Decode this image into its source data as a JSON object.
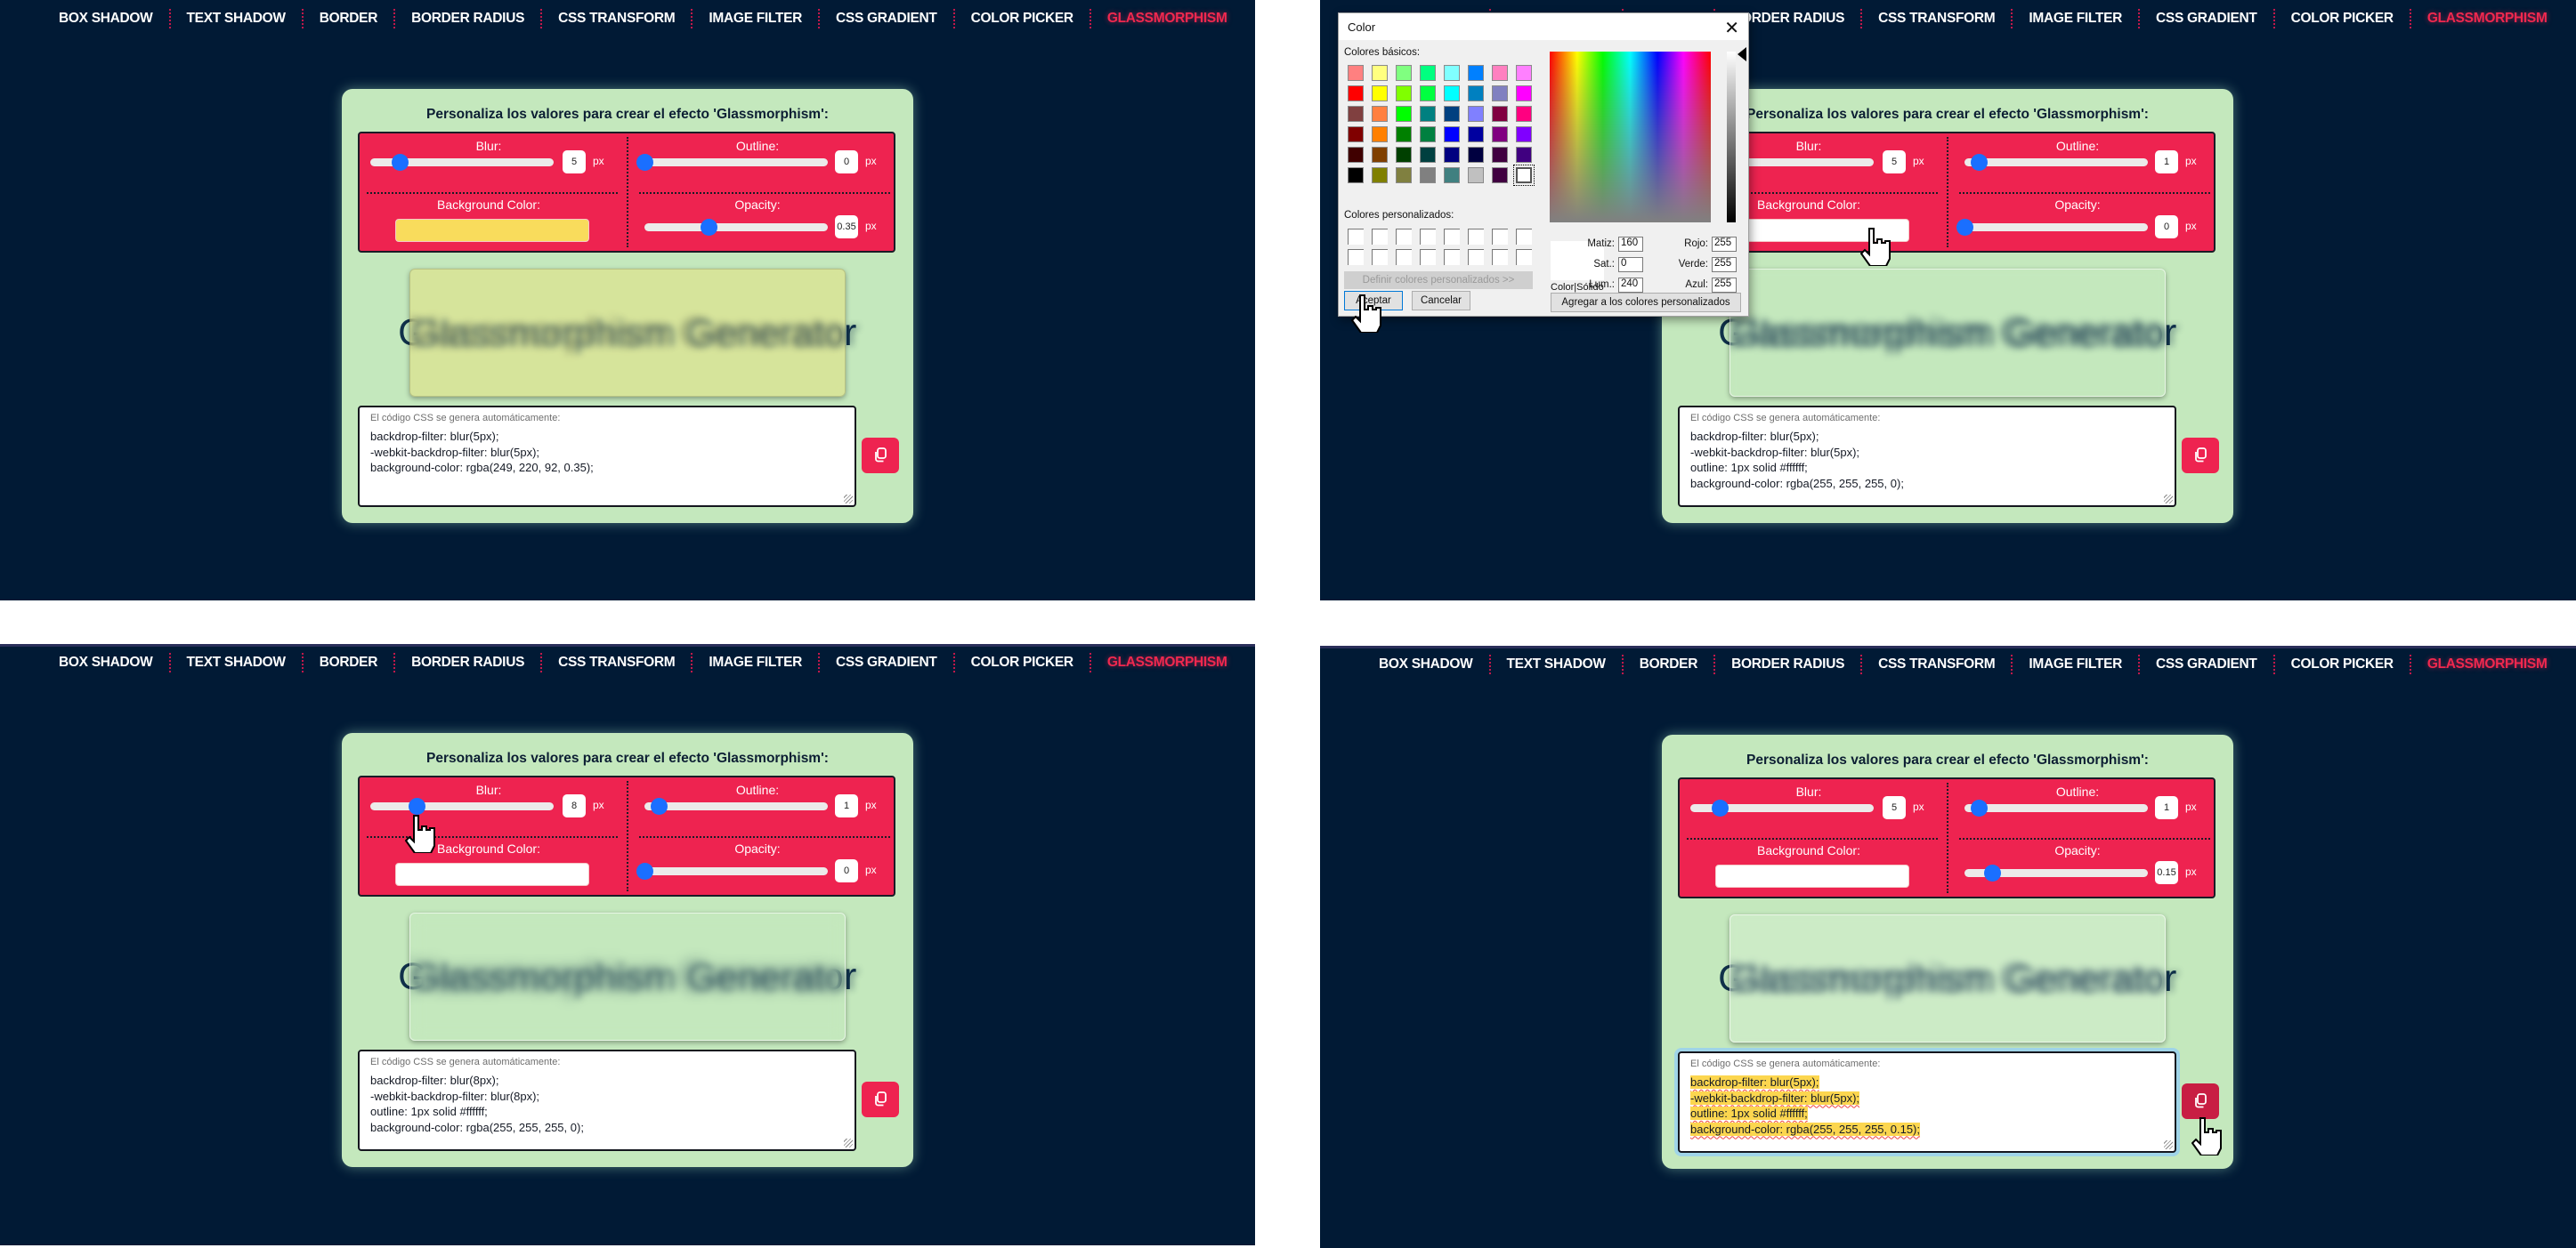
{
  "nav": {
    "items": [
      "BOX SHADOW",
      "TEXT SHADOW",
      "BORDER",
      "BORDER RADIUS",
      "CSS TRANSFORM",
      "IMAGE FILTER",
      "CSS GRADIENT",
      "COLOR PICKER",
      "GLASSMORPHISM"
    ],
    "active": "GLASSMORPHISM"
  },
  "panel": {
    "title": "Personaliza los valores para crear el efecto 'Glassmorphism':",
    "labels": {
      "blur": "Blur:",
      "outline": "Outline:",
      "bgcolor": "Background Color:",
      "opacity": "Opacity:",
      "unit": "px"
    },
    "preview_text": "Glassmorphism Generator",
    "code_placeholder": "El código CSS se genera automáticamente:"
  },
  "frames": [
    {
      "blur": 5,
      "blur_fraction": 0.16,
      "outline": 0,
      "outline_fraction": 0.0,
      "opacity": "0.35",
      "opacity_fraction": 0.35,
      "bg_color": "#f9dc5c",
      "code": [
        "backdrop-filter:  blur(5px);",
        "-webkit-backdrop-filter:  blur(5px);",
        "background-color: rgba(249, 220, 92, 0.35);"
      ]
    },
    {
      "blur": 5,
      "blur_fraction": 0.16,
      "outline": 1,
      "outline_fraction": 0.08,
      "opacity": "0",
      "opacity_fraction": 0.0,
      "bg_color": "#ffffff",
      "code": [
        "backdrop-filter:  blur(5px);",
        "-webkit-backdrop-filter:  blur(5px);",
        "outline: 1px solid #ffffff;",
        "background-color: rgba(255, 255, 255, 0);"
      ]
    },
    {
      "blur": 8,
      "blur_fraction": 0.25,
      "outline": 1,
      "outline_fraction": 0.08,
      "opacity": "0",
      "opacity_fraction": 0.0,
      "bg_color": "#ffffff",
      "code": [
        "backdrop-filter:  blur(8px);",
        "-webkit-backdrop-filter:  blur(8px);",
        "outline: 1px solid #ffffff;",
        "background-color: rgba(255, 255, 255, 0);"
      ]
    },
    {
      "blur": 5,
      "blur_fraction": 0.16,
      "outline": 1,
      "outline_fraction": 0.08,
      "opacity": "0.15",
      "opacity_fraction": 0.15,
      "bg_color": "#ffffff",
      "code": [
        "backdrop-filter:  blur(5px);",
        "-webkit-backdrop-filter:  blur(5px);",
        "outline: 1px solid #ffffff;",
        "background-color: rgba(255, 255, 255, 0.15);"
      ],
      "code_selected": true
    }
  ],
  "color_dialog": {
    "title": "Color",
    "basic_colors_label": "Colores básicos:",
    "basic_colors": [
      "#ff8080",
      "#ffff80",
      "#80ff80",
      "#00ff80",
      "#80ffff",
      "#0080ff",
      "#ff80c0",
      "#ff80ff",
      "#ff0000",
      "#ffff00",
      "#80ff00",
      "#00ff40",
      "#00ffff",
      "#0080c0",
      "#8080c0",
      "#ff00ff",
      "#804040",
      "#ff8040",
      "#00ff00",
      "#008080",
      "#004080",
      "#8080ff",
      "#800040",
      "#ff0080",
      "#800000",
      "#ff8000",
      "#008000",
      "#008040",
      "#0000ff",
      "#0000a0",
      "#800080",
      "#8000ff",
      "#400000",
      "#804000",
      "#004000",
      "#004040",
      "#000080",
      "#000040",
      "#400040",
      "#400080",
      "#000000",
      "#808000",
      "#808040",
      "#808080",
      "#408080",
      "#c0c0c0",
      "#400040",
      "#ffffff"
    ],
    "selected_basic_index": 47,
    "custom_colors_label": "Colores personalizados:",
    "define_button": "Definir colores personalizados >>",
    "ok_button": "Aceptar",
    "cancel_button": "Cancelar",
    "add_button": "Agregar a los colores personalizados",
    "sample_label": "Color|Sólido",
    "fields": {
      "hue_label": "Matiz:",
      "hue": "160",
      "sat_label": "Sat.:",
      "sat": "0",
      "lum_label": "Lum.:",
      "lum": "240",
      "red_label": "Rojo:",
      "red": "255",
      "green_label": "Verde:",
      "green": "255",
      "blue_label": "Azul:",
      "blue": "255"
    }
  },
  "colors": {
    "page_bg": "#011a35",
    "panel_bg": "#c4e8bd",
    "accent_red": "#ee2350",
    "slider_thumb": "#1a6fff",
    "nav_active": "#f0284f",
    "selection_highlight": "#fcd64f"
  }
}
